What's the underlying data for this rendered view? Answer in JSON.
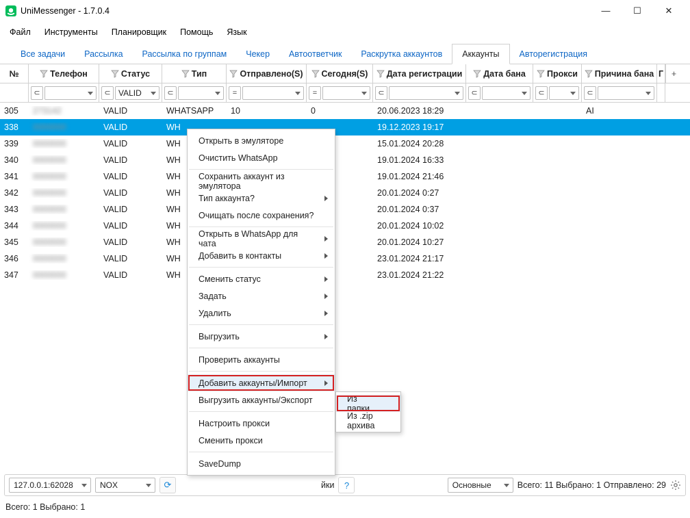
{
  "title": "UniMessenger - 1.7.0.4",
  "menubar": [
    "Файл",
    "Инструменты",
    "Планировщик",
    "Помощь",
    "Язык"
  ],
  "tabs": [
    "Все задачи",
    "Рассылка",
    "Рассылка по группам",
    "Чекер",
    "Автоответчик",
    "Раскрутка аккаунтов",
    "Аккаунты",
    "Авторегистрация"
  ],
  "active_tab_index": 6,
  "columns": [
    "№",
    "Телефон",
    "Статус",
    "Тип",
    "Отправлено(S)",
    "Сегодня(S)",
    "Дата регистрации",
    "Дата бана",
    "Прокси",
    "Причина бана"
  ],
  "filter_value_status": "VALID",
  "rows": [
    {
      "no": "305",
      "phone": "273142",
      "status": "VALID",
      "type": "WHATSAPP",
      "sent": "10",
      "today": "0",
      "reg": "20.06.2023 18:29",
      "extra": "AI"
    },
    {
      "no": "338",
      "phone": "",
      "status": "VALID",
      "type": "WH",
      "sent": "",
      "today": "",
      "reg": "19.12.2023 19:17",
      "selected": true
    },
    {
      "no": "339",
      "phone": "",
      "status": "VALID",
      "type": "WH",
      "sent": "",
      "today": "",
      "reg": "15.01.2024 20:28"
    },
    {
      "no": "340",
      "phone": "",
      "status": "VALID",
      "type": "WH",
      "sent": "",
      "today": "",
      "reg": "19.01.2024 16:33"
    },
    {
      "no": "341",
      "phone": "",
      "status": "VALID",
      "type": "WH",
      "sent": "",
      "today": "",
      "reg": "19.01.2024 21:46"
    },
    {
      "no": "342",
      "phone": "",
      "status": "VALID",
      "type": "WH",
      "sent": "",
      "today": "",
      "reg": "20.01.2024 0:27"
    },
    {
      "no": "343",
      "phone": "",
      "status": "VALID",
      "type": "WH",
      "sent": "",
      "today": "",
      "reg": "20.01.2024 0:37"
    },
    {
      "no": "344",
      "phone": "",
      "status": "VALID",
      "type": "WH",
      "sent": "",
      "today": "",
      "reg": "20.01.2024 10:02"
    },
    {
      "no": "345",
      "phone": "",
      "status": "VALID",
      "type": "WH",
      "sent": "",
      "today": "",
      "reg": "20.01.2024 10:27"
    },
    {
      "no": "346",
      "phone": "",
      "status": "VALID",
      "type": "WH",
      "sent": "",
      "today": "",
      "reg": "23.01.2024 21:17"
    },
    {
      "no": "347",
      "phone": "",
      "status": "VALID",
      "type": "WH",
      "sent": "",
      "today": "",
      "reg": "23.01.2024 21:22"
    }
  ],
  "context_menu": {
    "groups": [
      [
        "Открыть в эмуляторе",
        "Очистить WhatsApp"
      ],
      [
        "Сохранить аккаунт из эмулятора",
        {
          "label": "Тип аккаунта?",
          "sub": true
        },
        "Очищать после сохранения?"
      ],
      [
        {
          "label": "Открыть в WhatsApp для чата",
          "sub": true
        },
        {
          "label": "Добавить в контакты",
          "sub": true
        }
      ],
      [
        {
          "label": "Сменить статус",
          "sub": true
        },
        {
          "label": "Задать",
          "sub": true
        },
        {
          "label": "Удалить",
          "sub": true
        }
      ],
      [
        {
          "label": "Выгрузить",
          "sub": true
        }
      ],
      [
        "Проверить аккаунты"
      ],
      [
        {
          "label": "Добавить аккаунты/Импорт",
          "sub": true,
          "highlight": true,
          "boxed": true
        },
        "Выгрузить аккаунты/Экспорт"
      ],
      [
        "Настроить прокси",
        "Сменить прокси"
      ],
      [
        "SaveDump"
      ]
    ],
    "submenu_items": [
      {
        "label": "Из папки",
        "boxed": true
      },
      {
        "label": "Из .zip архива"
      }
    ]
  },
  "bottom_toolbar": {
    "combo_ip": "127.0.0.1:62028",
    "combo_emulator": "NOX",
    "hidden_btn_text_tail": "йки",
    "combo_filter": "Основные",
    "stats": "Всего: 11 Выбрано: 1 Отправлено: 29"
  },
  "statusbar": "Всего: 1 Выбрано: 1"
}
